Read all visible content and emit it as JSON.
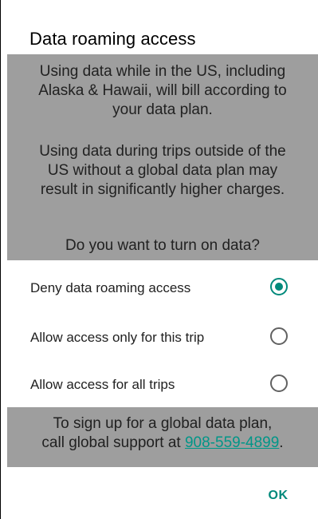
{
  "dialog": {
    "title": "Data roaming access",
    "message": {
      "paragraph1": {
        "line1": "Using data while in the US, including",
        "line2": "Alaska & Hawaii, will bill according to",
        "line3": "your data plan."
      },
      "paragraph2": {
        "line1": "Using data during trips outside of the",
        "line2": "US without a global data plan may",
        "line3": "result in significantly higher charges."
      },
      "question": "Do you want to turn on data?"
    },
    "options": [
      {
        "label": "Deny data roaming access",
        "checked": true
      },
      {
        "label": "Allow access only for this trip",
        "checked": false
      },
      {
        "label": "Allow access for all trips",
        "checked": false
      }
    ],
    "footer": {
      "line1": "To sign up for a global data plan,",
      "line2_prefix": "call global support at ",
      "phone": "908-559-4899",
      "line2_suffix": "."
    },
    "ok_label": "OK"
  },
  "colors": {
    "accent": "#00897b",
    "highlight_bg": "#9e9e9e",
    "link": "#009688"
  }
}
